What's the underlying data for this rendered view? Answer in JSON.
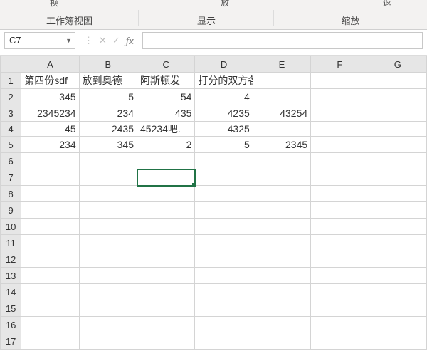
{
  "ribbon": {
    "partial1": "换",
    "partial2": "放",
    "partial3": "返",
    "groups": [
      "工作簿视图",
      "显示",
      "缩放"
    ]
  },
  "namebox": {
    "cell_ref": "C7"
  },
  "formula": {
    "value": ""
  },
  "icons": {
    "cancel": "✕",
    "confirm": "✓",
    "fx": "fx",
    "dropdown": "▼",
    "dots": "⋮"
  },
  "columns": [
    "A",
    "B",
    "C",
    "D",
    "E",
    "F",
    "G"
  ],
  "rows": [
    "1",
    "2",
    "3",
    "4",
    "5",
    "6",
    "7",
    "8",
    "9",
    "10",
    "11",
    "12",
    "13",
    "14",
    "15",
    "16",
    "17"
  ],
  "selected": {
    "col": "C",
    "row": "7"
  },
  "cells": {
    "A1": "第四份sdf",
    "B1": "放到奥德",
    "C1": "阿斯顿发",
    "D1": "打分的双方各",
    "A2": "345",
    "B2": "5",
    "C2": "54",
    "D2": "4",
    "A3": "2345234",
    "B3": "234",
    "C3": "435",
    "D3": "4235",
    "E3": "43254",
    "A4": "45",
    "B4": "2435",
    "C4": "45234吧.",
    "D4": "4325",
    "A5": "234",
    "B5": "345",
    "C5": "2",
    "D5": "5",
    "E5": "2345"
  },
  "cell_align": {
    "A1": "txt",
    "B1": "txt",
    "C1": "txt",
    "D1": "txt",
    "C4": "txt"
  }
}
